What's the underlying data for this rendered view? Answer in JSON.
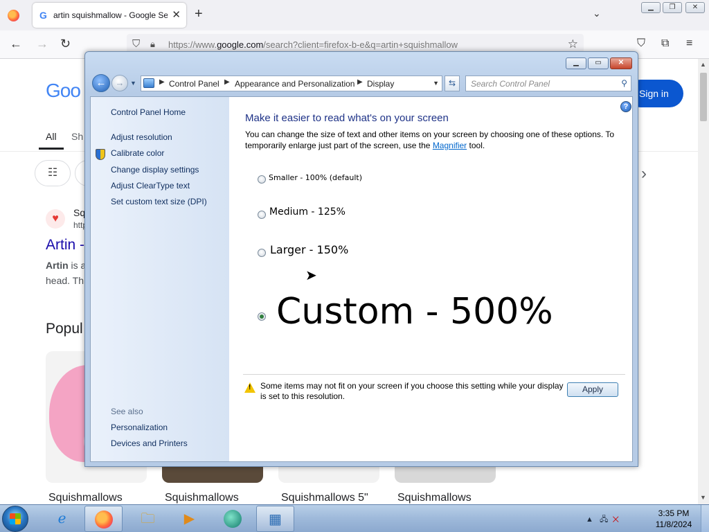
{
  "firefox": {
    "tab_title": "artin squishmallow - Google Se",
    "tab_close": "✕",
    "new_tab": "+",
    "url_prefix": "https://www.",
    "url_domain": "google.com",
    "url_rest": "/search?client=firefox-b-e&q=artin+squishmallow"
  },
  "google": {
    "logo": "Goo",
    "sign_in": "Sign in",
    "tab_all": "All",
    "tab_partial": "Sh",
    "result_site": "Sq",
    "result_url": "http",
    "result_title": "Artin -",
    "snippet_bold": "Artin",
    "snippet_rest": " is a",
    "snippet_line2": "head. Th",
    "popular_heading": "Popul",
    "products": [
      "Squishmallows",
      "Squishmallows",
      "Squishmallows 5\"",
      "Squishmallows"
    ]
  },
  "control_panel": {
    "breadcrumbs": [
      "Control Panel",
      "Appearance and Personalization",
      "Display"
    ],
    "search_placeholder": "Search Control Panel",
    "sidebar": {
      "home": "Control Panel Home",
      "links": [
        "Adjust resolution",
        "Calibrate color",
        "Change display settings",
        "Adjust ClearType text",
        "Set custom text size (DPI)"
      ],
      "see_also_label": "See also",
      "see_also_links": [
        "Personalization",
        "Devices and Printers"
      ]
    },
    "heading": "Make it easier to read what's on your screen",
    "description_before": "You can change the size of text and other items on your screen by choosing one of these options. To temporarily enlarge just part of the screen, use the ",
    "description_link": "Magnifier",
    "description_after": " tool.",
    "options": [
      {
        "label": "Smaller - 100% (default)",
        "selected": false
      },
      {
        "label": "Medium - 125%",
        "selected": false
      },
      {
        "label": "Larger - 150%",
        "selected": false
      },
      {
        "label": "Custom - 500%",
        "selected": true
      }
    ],
    "warning": "Some items may not fit on your screen if you choose this setting while your display is set to this resolution.",
    "apply_label": "Apply"
  },
  "taskbar": {
    "time": "3:35 PM",
    "date": "11/8/2024"
  },
  "colors": {
    "heading_blue": "#1e3287",
    "link_blue": "#0066cc",
    "google_button": "#0b57d0",
    "selected_radio": "#2f7e3e"
  }
}
